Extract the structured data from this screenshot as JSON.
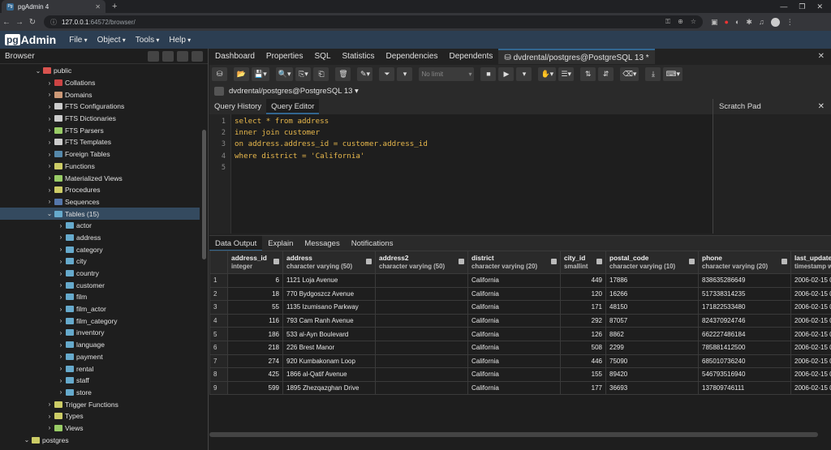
{
  "browser": {
    "tab_title": "pgAdmin 4",
    "url_host": "127.0.0.1",
    "url_rest": ":64572/browser/"
  },
  "app": {
    "logo": "Admin",
    "logo_prefix": "pg",
    "menus": [
      "File",
      "Object",
      "Tools",
      "Help"
    ]
  },
  "browser_panel": {
    "title": "Browser",
    "tree": [
      {
        "label": "public",
        "indent": 2,
        "exp": "v",
        "color": "#d9534f"
      },
      {
        "label": "Collations",
        "indent": 3,
        "exp": ">",
        "color": "#c44"
      },
      {
        "label": "Domains",
        "indent": 3,
        "exp": ">",
        "color": "#c97"
      },
      {
        "label": "FTS Configurations",
        "indent": 3,
        "exp": ">",
        "color": "#ccc"
      },
      {
        "label": "FTS Dictionaries",
        "indent": 3,
        "exp": ">",
        "color": "#ccc"
      },
      {
        "label": "FTS Parsers",
        "indent": 3,
        "exp": ">",
        "color": "#9c6"
      },
      {
        "label": "FTS Templates",
        "indent": 3,
        "exp": ">",
        "color": "#ccc"
      },
      {
        "label": "Foreign Tables",
        "indent": 3,
        "exp": ">",
        "color": "#58a"
      },
      {
        "label": "Functions",
        "indent": 3,
        "exp": ">",
        "color": "#cc6"
      },
      {
        "label": "Materialized Views",
        "indent": 3,
        "exp": ">",
        "color": "#9c6"
      },
      {
        "label": "Procedures",
        "indent": 3,
        "exp": ">",
        "color": "#cc6"
      },
      {
        "label": "Sequences",
        "indent": 3,
        "exp": ">",
        "color": "#57a"
      },
      {
        "label": "Tables (15)",
        "indent": 3,
        "exp": "v",
        "color": "#6ac",
        "selected": true
      },
      {
        "label": "actor",
        "indent": 4,
        "exp": ">",
        "color": "#6ac"
      },
      {
        "label": "address",
        "indent": 4,
        "exp": ">",
        "color": "#6ac"
      },
      {
        "label": "category",
        "indent": 4,
        "exp": ">",
        "color": "#6ac"
      },
      {
        "label": "city",
        "indent": 4,
        "exp": ">",
        "color": "#6ac"
      },
      {
        "label": "country",
        "indent": 4,
        "exp": ">",
        "color": "#6ac"
      },
      {
        "label": "customer",
        "indent": 4,
        "exp": ">",
        "color": "#6ac"
      },
      {
        "label": "film",
        "indent": 4,
        "exp": ">",
        "color": "#6ac"
      },
      {
        "label": "film_actor",
        "indent": 4,
        "exp": ">",
        "color": "#6ac"
      },
      {
        "label": "film_category",
        "indent": 4,
        "exp": ">",
        "color": "#6ac"
      },
      {
        "label": "inventory",
        "indent": 4,
        "exp": ">",
        "color": "#6ac"
      },
      {
        "label": "language",
        "indent": 4,
        "exp": ">",
        "color": "#6ac"
      },
      {
        "label": "payment",
        "indent": 4,
        "exp": ">",
        "color": "#6ac"
      },
      {
        "label": "rental",
        "indent": 4,
        "exp": ">",
        "color": "#6ac"
      },
      {
        "label": "staff",
        "indent": 4,
        "exp": ">",
        "color": "#6ac"
      },
      {
        "label": "store",
        "indent": 4,
        "exp": ">",
        "color": "#6ac"
      },
      {
        "label": "Trigger Functions",
        "indent": 3,
        "exp": ">",
        "color": "#cc6"
      },
      {
        "label": "Types",
        "indent": 3,
        "exp": ">",
        "color": "#cc6"
      },
      {
        "label": "Views",
        "indent": 3,
        "exp": ">",
        "color": "#9c6"
      },
      {
        "label": "postgres",
        "indent": 1,
        "exp": "v",
        "color": "#cc6"
      }
    ]
  },
  "main_tabs": [
    "Dashboard",
    "Properties",
    "SQL",
    "Statistics",
    "Dependencies",
    "Dependents"
  ],
  "query_tab": "dvdrental/postgres@PostgreSQL 13 *",
  "toolbar": {
    "limit": "No limit"
  },
  "connection": "dvdrental/postgres@PostgreSQL 13",
  "sub_tabs": [
    "Query History",
    "Query Editor"
  ],
  "scratch_pad": "Scratch Pad",
  "editor": {
    "line_numbers": [
      "1",
      "2",
      "3",
      "4",
      "5"
    ],
    "lines": [
      "select * from address",
      "inner join customer",
      "on address.address_id = customer.address_id",
      "where district = 'California'",
      ""
    ]
  },
  "result_tabs": [
    "Data Output",
    "Explain",
    "Messages",
    "Notifications"
  ],
  "grid": {
    "columns": [
      {
        "name": "address_id",
        "type": "integer",
        "w": 68,
        "num": true
      },
      {
        "name": "address",
        "type": "character varying (50)",
        "w": 114
      },
      {
        "name": "address2",
        "type": "character varying (50)",
        "w": 114
      },
      {
        "name": "district",
        "type": "character varying (20)",
        "w": 114
      },
      {
        "name": "city_id",
        "type": "smallint",
        "w": 56,
        "num": true
      },
      {
        "name": "postal_code",
        "type": "character varying (10)",
        "w": 114
      },
      {
        "name": "phone",
        "type": "character varying (20)",
        "w": 114
      },
      {
        "name": "last_update",
        "type": "timestamp wi",
        "w": 80
      }
    ],
    "rows": [
      [
        "1",
        "6",
        "1121 Loja Avenue",
        "",
        "California",
        "449",
        "17886",
        "838635286649",
        "2006-02-15 0"
      ],
      [
        "2",
        "18",
        "770 Bydgoszcz Avenue",
        "",
        "California",
        "120",
        "16266",
        "517338314235",
        "2006-02-15 0"
      ],
      [
        "3",
        "55",
        "1135 Izumisano Parkway",
        "",
        "California",
        "171",
        "48150",
        "171822533480",
        "2006-02-15 0"
      ],
      [
        "4",
        "116",
        "793 Cam Ranh Avenue",
        "",
        "California",
        "292",
        "87057",
        "824370924746",
        "2006-02-15 0"
      ],
      [
        "5",
        "186",
        "533 al-Ayn Boulevard",
        "",
        "California",
        "126",
        "8862",
        "662227486184",
        "2006-02-15 0"
      ],
      [
        "6",
        "218",
        "226 Brest Manor",
        "",
        "California",
        "508",
        "2299",
        "785881412500",
        "2006-02-15 0"
      ],
      [
        "7",
        "274",
        "920 Kumbakonam Loop",
        "",
        "California",
        "446",
        "75090",
        "685010736240",
        "2006-02-15 0"
      ],
      [
        "8",
        "425",
        "1866 al-Qatif Avenue",
        "",
        "California",
        "155",
        "89420",
        "546793516940",
        "2006-02-15 0"
      ],
      [
        "9",
        "599",
        "1895 Zhezqazghan Drive",
        "",
        "California",
        "177",
        "36693",
        "137809746111",
        "2006-02-15 0"
      ]
    ]
  }
}
